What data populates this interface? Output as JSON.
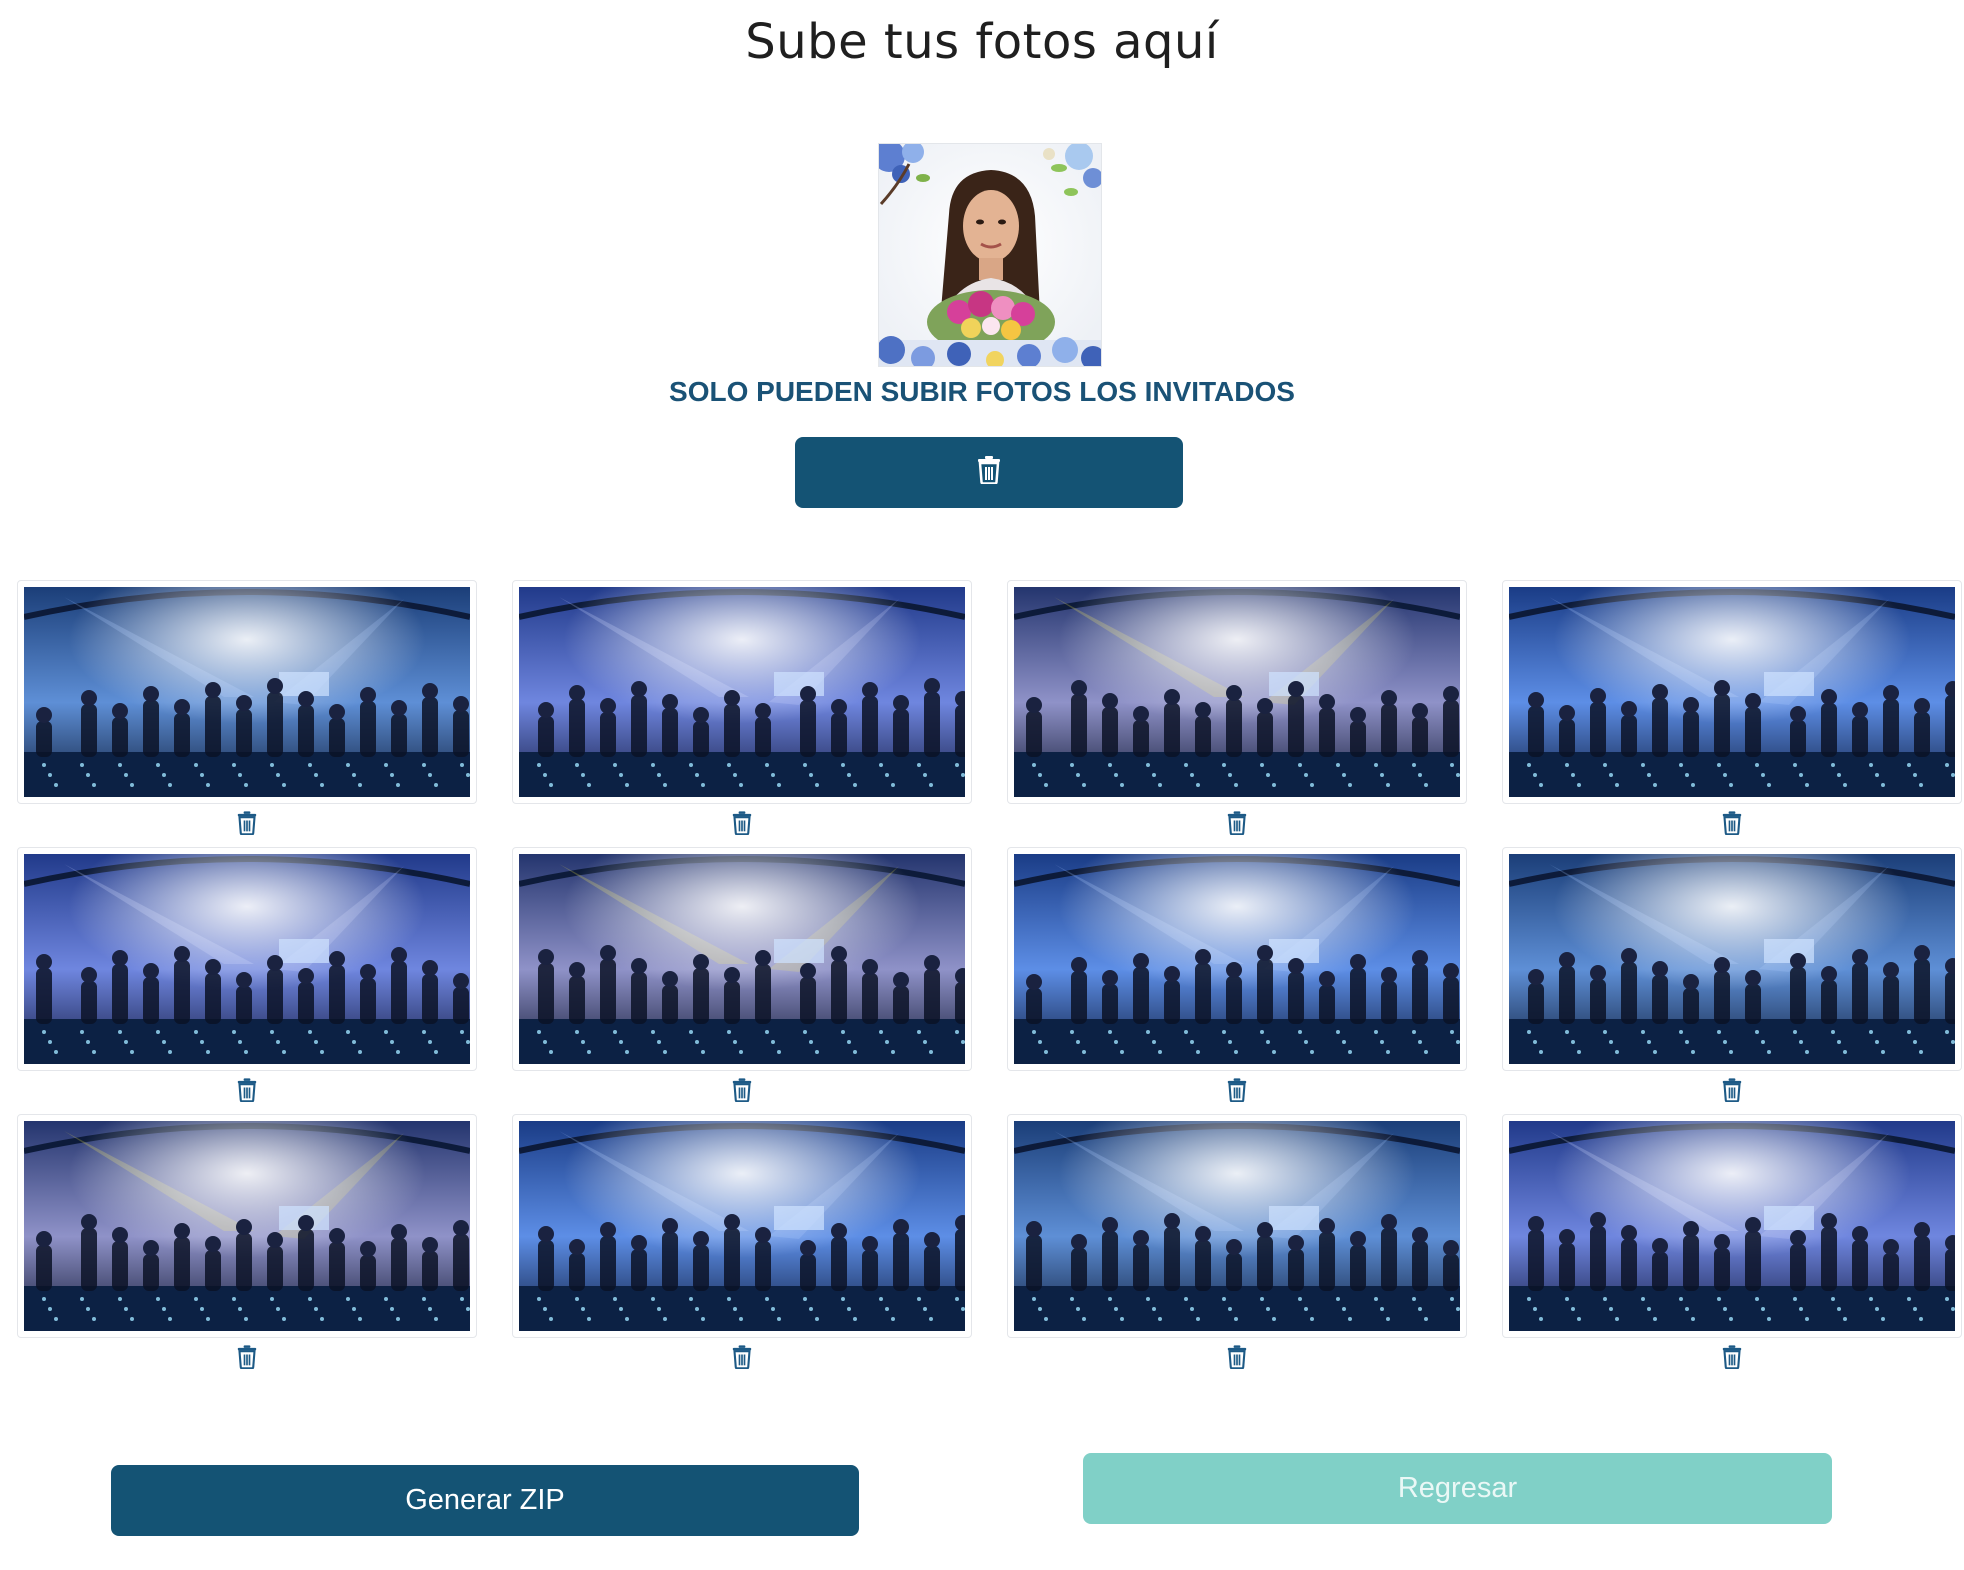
{
  "page": {
    "title": "Sube tus fotos aquí"
  },
  "profile": {
    "image_alt": "Foto de perfil"
  },
  "notice": {
    "text": "SOLO PUEDEN SUBIR FOTOS LOS INVITADOS"
  },
  "delete_all": {
    "icon": "trash-icon"
  },
  "gallery": {
    "photos": [
      {
        "id": 1,
        "delete_icon": "trash-icon"
      },
      {
        "id": 2,
        "delete_icon": "trash-icon"
      },
      {
        "id": 3,
        "delete_icon": "trash-icon"
      },
      {
        "id": 4,
        "delete_icon": "trash-icon"
      },
      {
        "id": 5,
        "delete_icon": "trash-icon"
      },
      {
        "id": 6,
        "delete_icon": "trash-icon"
      },
      {
        "id": 7,
        "delete_icon": "trash-icon"
      },
      {
        "id": 8,
        "delete_icon": "trash-icon"
      },
      {
        "id": 9,
        "delete_icon": "trash-icon"
      },
      {
        "id": 10,
        "delete_icon": "trash-icon"
      },
      {
        "id": 11,
        "delete_icon": "trash-icon"
      },
      {
        "id": 12,
        "delete_icon": "trash-icon"
      }
    ]
  },
  "actions": {
    "zip_label": "Generar ZIP",
    "back_label": "Regresar"
  },
  "colors": {
    "primary": "#145374",
    "secondary": "#80d0c7",
    "notice": "#1a5276"
  }
}
